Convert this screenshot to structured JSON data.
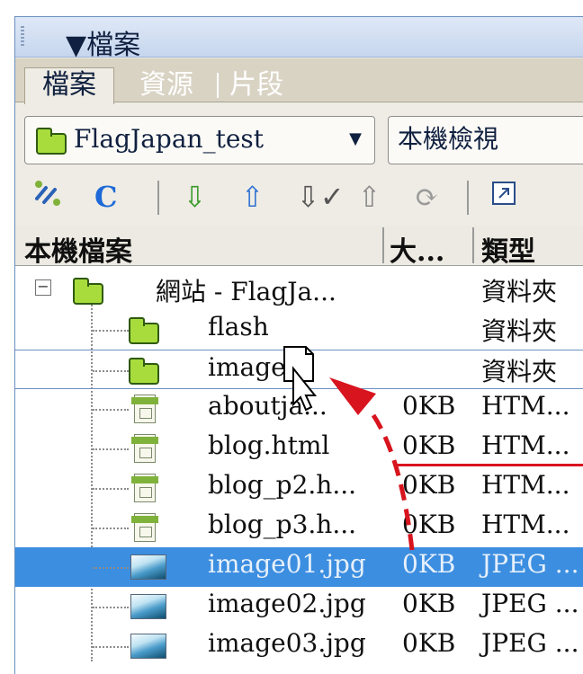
{
  "panel": {
    "title": "▼檔案",
    "tabs": [
      {
        "label": "檔案",
        "active": true
      },
      {
        "label": "資源",
        "active": false
      },
      {
        "label": "片段",
        "active": false
      }
    ]
  },
  "site_select": {
    "value": "FlagJapan_test"
  },
  "view_select": {
    "value": "本機檢視"
  },
  "toolbar": {
    "icons": [
      "connect-icon",
      "refresh-icon",
      "get-down-arrow-icon",
      "put-up-arrow-icon",
      "check-out-icon",
      "check-in-icon",
      "synchronize-icon",
      "expand-icon"
    ]
  },
  "columns": {
    "name": "本機檔案",
    "size": "大...",
    "type": "類型"
  },
  "files": [
    {
      "name": "網站 - FlagJa...",
      "size": "",
      "type": "資料夾",
      "icon": "folder-icon"
    },
    {
      "name": "flash",
      "size": "",
      "type": "資料夾",
      "icon": "folder-icon"
    },
    {
      "name": "image",
      "size": "",
      "type": "資料夾",
      "icon": "folder-icon"
    },
    {
      "name": "aboutja...",
      "size": "0KB",
      "type": "HTM...",
      "icon": "html-file-icon"
    },
    {
      "name": "blog.html",
      "size": "0KB",
      "type": "HTM...",
      "icon": "html-file-icon"
    },
    {
      "name": "blog_p2.h...",
      "size": "0KB",
      "type": "HTM...",
      "icon": "html-file-icon"
    },
    {
      "name": "blog_p3.h...",
      "size": "0KB",
      "type": "HTM...",
      "icon": "html-file-icon"
    },
    {
      "name": "image01.jpg",
      "size": "0KB",
      "type": "JPEG ...",
      "icon": "jpeg-file-icon",
      "selected": true
    },
    {
      "name": "image02.jpg",
      "size": "0KB",
      "type": "JPEG ...",
      "icon": "jpeg-file-icon"
    },
    {
      "name": "image03.jpg",
      "size": "0KB",
      "type": "JPEG ...",
      "icon": "jpeg-file-icon"
    }
  ],
  "colors": {
    "selection": "#3c8ee0",
    "annotation": "#d8141e",
    "folder": "#a8dc3c"
  }
}
